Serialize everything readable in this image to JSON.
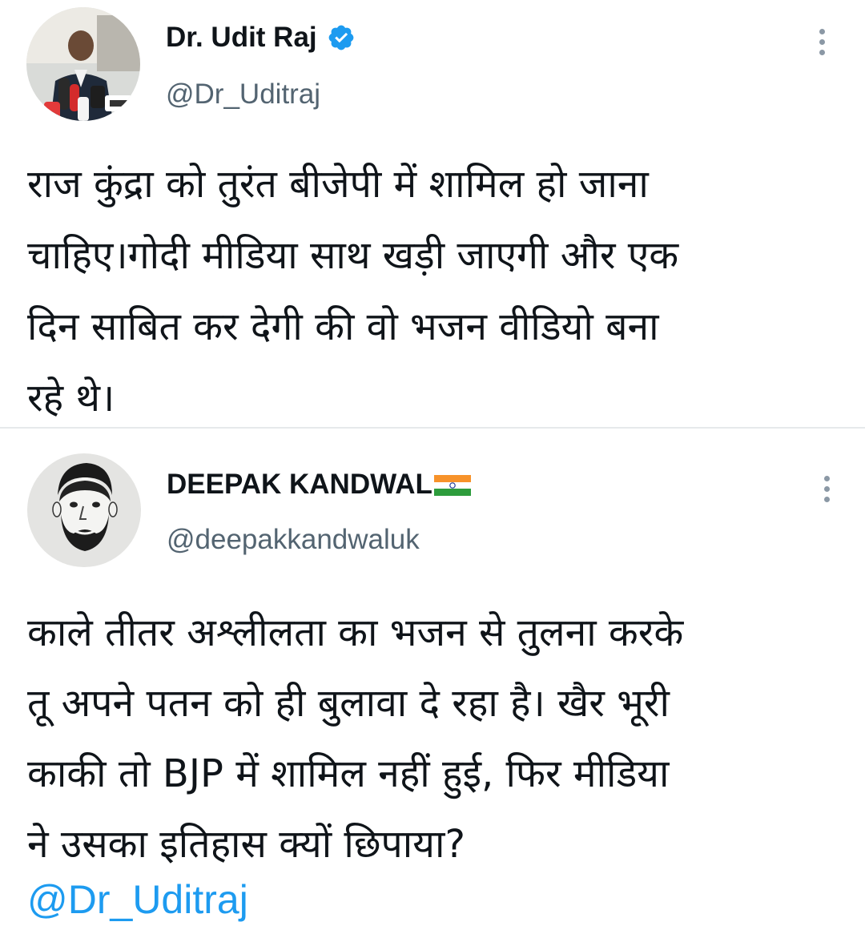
{
  "tweets": [
    {
      "display_name": "Dr. Udit Raj",
      "handle": "@Dr_Uditraj",
      "verified": true,
      "avatar_icon": "profile-photo-with-microphones",
      "text": "राज कुंद्रा को तुरंत बीजेपी में शामिल हो जाना\nचाहिए।गोदी मीडिया साथ खड़ी जाएगी और एक\nदिन साबित कर देगी की वो भजन वीडियो बना\nरहे थे।"
    },
    {
      "display_name": "DEEPAK KANDWAL",
      "handle": "@deepakkandwaluk",
      "verified": false,
      "flag_icon": "india-flag-icon",
      "avatar_icon": "bearded-man-sketch-avatar",
      "text": "काले तीतर अश्लीलता का भजन से तुलना करके\nतू अपने पतन को ही बुलावा दे रहा है। खैर भूरी\nकाकी तो BJP में शामिल नहीं हुई, फिर मीडिया\nने उसका इतिहास क्यों छिपाया?",
      "mention": "@Dr_Uditraj"
    }
  ],
  "colors": {
    "text": "#0f1419",
    "secondary": "#536471",
    "link": "#1d9bf0",
    "verified": "#1d9bf0",
    "divider": "#e6e9eb"
  },
  "icons": [
    "verified-badge-icon",
    "more-options-icon",
    "india-flag-icon"
  ]
}
